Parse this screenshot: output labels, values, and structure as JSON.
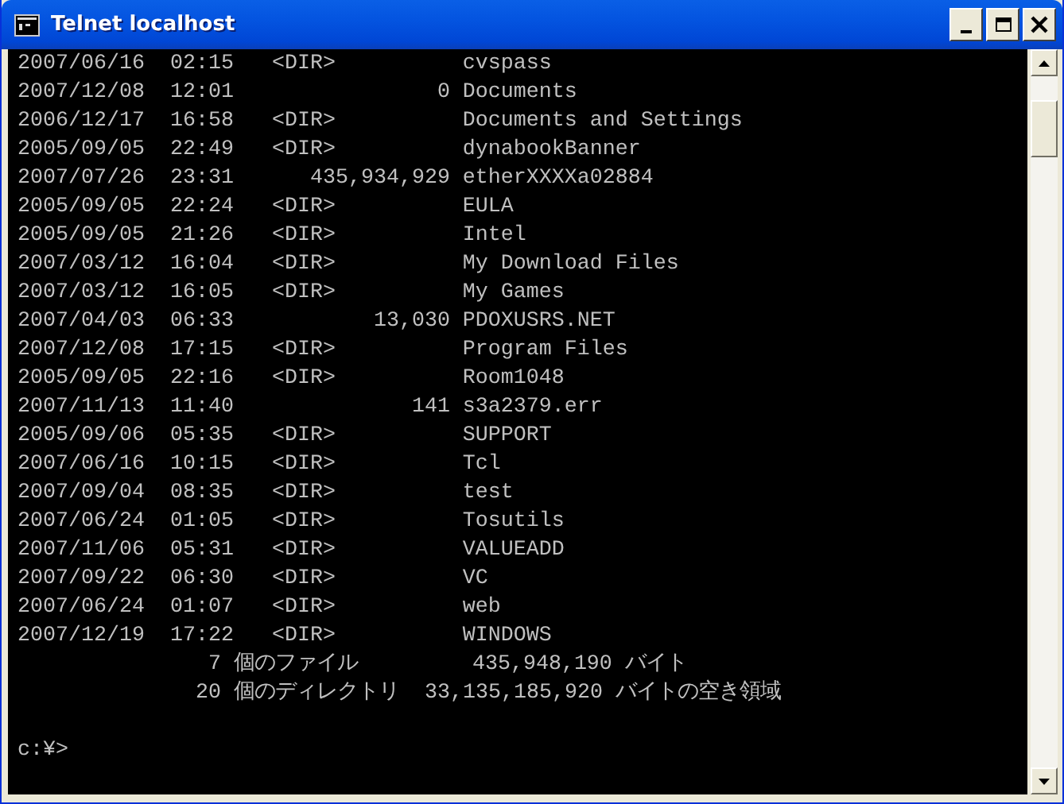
{
  "window": {
    "title": "Telnet localhost"
  },
  "console": {
    "lines": [
      "2007/06/16  02:15   <DIR>          cvspass",
      "2007/12/08  12:01                0 Documents",
      "2006/12/17  16:58   <DIR>          Documents and Settings",
      "2005/09/05  22:49   <DIR>          dynabookBanner",
      "2007/07/26  23:31      435,934,929 etherXXXXa02884",
      "2005/09/05  22:24   <DIR>          EULA",
      "2005/09/05  21:26   <DIR>          Intel",
      "2007/03/12  16:04   <DIR>          My Download Files",
      "2007/03/12  16:05   <DIR>          My Games",
      "2007/04/03  06:33           13,030 PDOXUSRS.NET",
      "2007/12/08  17:15   <DIR>          Program Files",
      "2005/09/05  22:16   <DIR>          Room1048",
      "2007/11/13  11:40              141 s3a2379.err",
      "2005/09/06  05:35   <DIR>          SUPPORT",
      "2007/06/16  10:15   <DIR>          Tcl",
      "2007/09/04  08:35   <DIR>          test",
      "2007/06/24  01:05   <DIR>          Tosutils",
      "2007/11/06  05:31   <DIR>          VALUEADD",
      "2007/09/22  06:30   <DIR>          VC",
      "2007/06/24  01:07   <DIR>          web",
      "2007/12/19  17:22   <DIR>          WINDOWS",
      "               7 個のファイル         435,948,190 バイト",
      "              20 個のディレクトリ  33,135,185,920 バイトの空き領域"
    ],
    "prompt": "c:¥>"
  }
}
